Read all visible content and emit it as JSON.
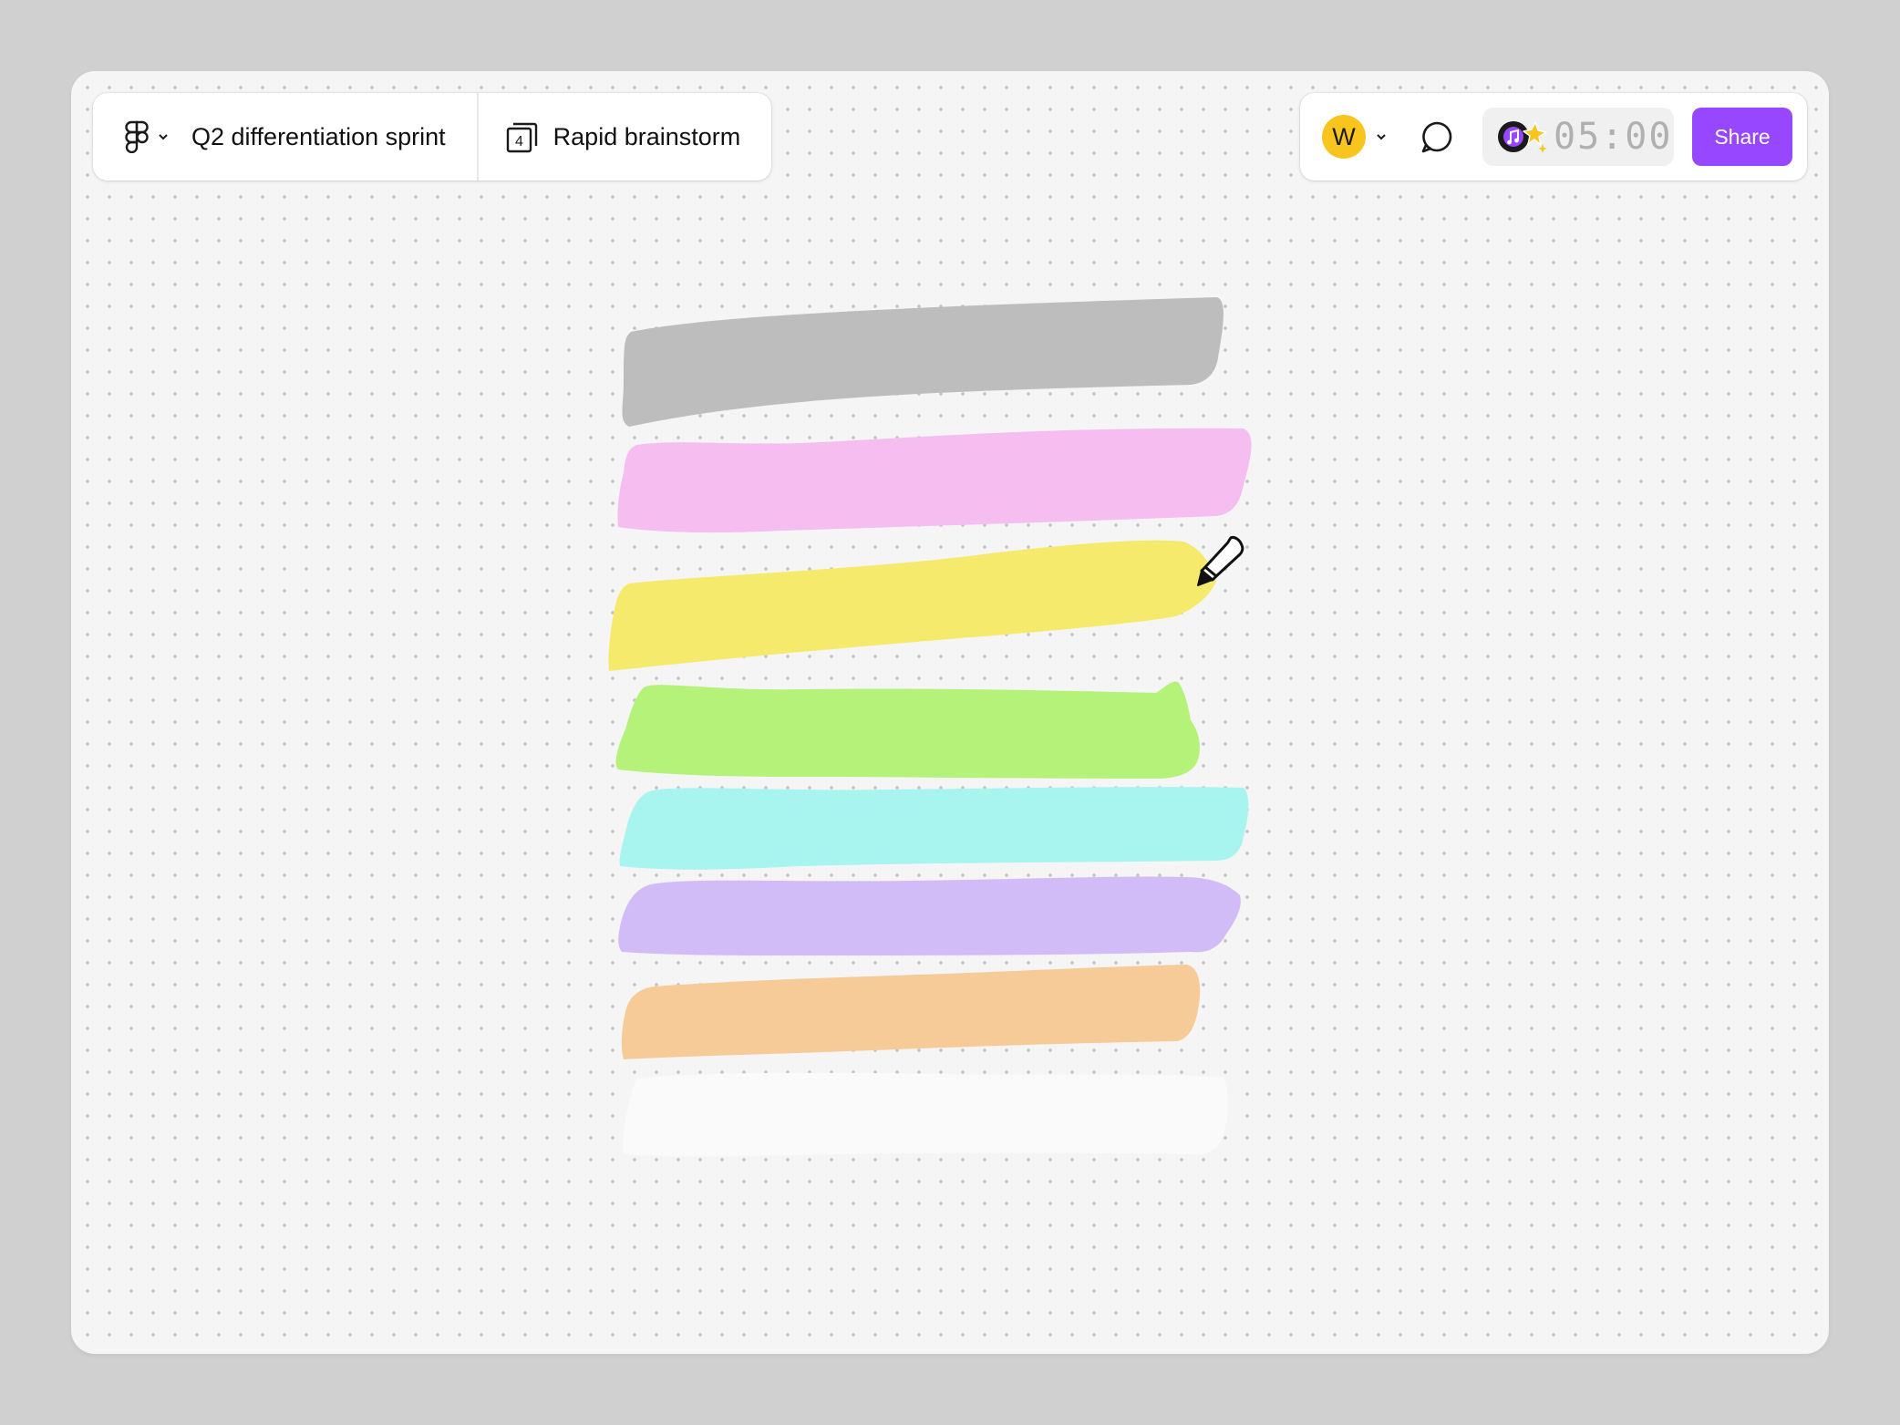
{
  "file": {
    "title": "Q2 differentiation sprint"
  },
  "page": {
    "count": "4",
    "title": "Rapid brainstorm"
  },
  "user": {
    "avatar_initial": "W",
    "avatar_color": "#f7c51e"
  },
  "timer": {
    "value": "05:00"
  },
  "share": {
    "label": "Share",
    "color": "#9747ff"
  },
  "icons": {
    "main_menu": "figma-logo-icon",
    "page": "pages-stack-icon",
    "comment": "comment-bubble-icon",
    "music": "music-sparkle-icon",
    "cursor": "marker-pen-cursor-icon"
  },
  "marker_strokes": [
    {
      "name": "gray",
      "color": "#bdbdbd"
    },
    {
      "name": "pink",
      "color": "#f5bdf0"
    },
    {
      "name": "yellow",
      "color": "#f5ea6b"
    },
    {
      "name": "green",
      "color": "#b5f27a"
    },
    {
      "name": "cyan",
      "color": "#a8f5ef"
    },
    {
      "name": "violet",
      "color": "#d1bcf7"
    },
    {
      "name": "orange",
      "color": "#f7cb98"
    },
    {
      "name": "white",
      "color": "#fafafa"
    }
  ]
}
